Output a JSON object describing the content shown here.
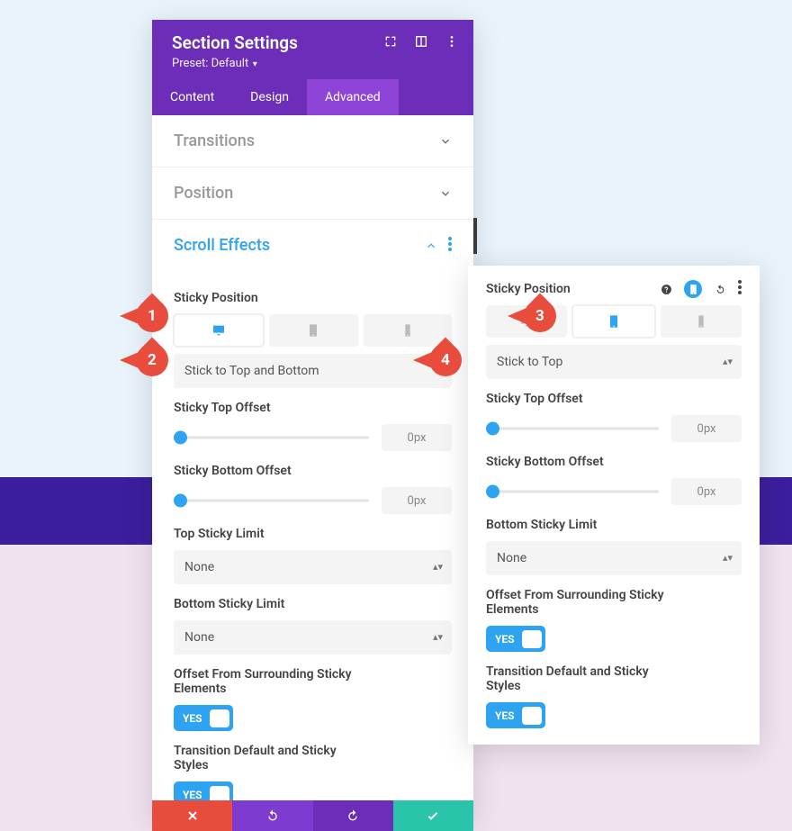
{
  "header": {
    "title": "Section Settings",
    "preset": "Preset: Default"
  },
  "tabs": {
    "content": "Content",
    "design": "Design",
    "advanced": "Advanced"
  },
  "sections": {
    "transitions": "Transitions",
    "position": "Position",
    "scroll_effects": "Scroll Effects"
  },
  "panel1": {
    "sticky_position_label": "Sticky Position",
    "sticky_select": "Stick to Top and Bottom",
    "sticky_top_offset_label": "Sticky Top Offset",
    "sticky_top_offset_value": "0px",
    "sticky_bottom_offset_label": "Sticky Bottom Offset",
    "sticky_bottom_offset_value": "0px",
    "top_sticky_limit_label": "Top Sticky Limit",
    "top_sticky_limit_value": "None",
    "bottom_sticky_limit_label": "Bottom Sticky Limit",
    "bottom_sticky_limit_value": "None",
    "offset_surround_label": "Offset From Surrounding Sticky Elements",
    "offset_surround_toggle": "YES",
    "transition_styles_label": "Transition Default and Sticky Styles",
    "transition_styles_toggle": "YES"
  },
  "panel2": {
    "sticky_position_label": "Sticky Position",
    "sticky_select": "Stick to Top",
    "sticky_top_offset_label": "Sticky Top Offset",
    "sticky_top_offset_value": "0px",
    "sticky_bottom_offset_label": "Sticky Bottom Offset",
    "sticky_bottom_offset_value": "0px",
    "bottom_sticky_limit_label": "Bottom Sticky Limit",
    "bottom_sticky_limit_value": "None",
    "offset_surround_label": "Offset From Surrounding Sticky Elements",
    "offset_surround_toggle": "YES",
    "transition_styles_label": "Transition Default and Sticky Styles",
    "transition_styles_toggle": "YES"
  },
  "markers": {
    "m1": "1",
    "m2": "2",
    "m3": "3",
    "m4": "4"
  }
}
